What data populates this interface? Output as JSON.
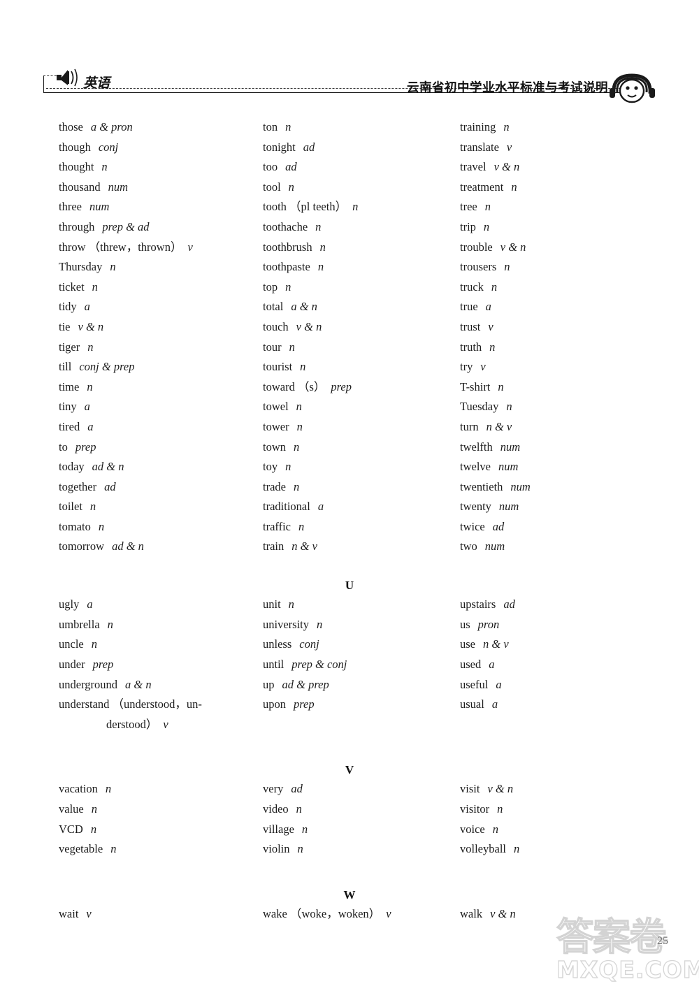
{
  "header": {
    "subject_label": "英语",
    "title": "云南省初中学业水平标准与考试说明",
    "speaker_icon": "speaker-icon",
    "badge_icon": "headphone-face-icon"
  },
  "watermark": {
    "chinese": "答案卷",
    "domain": "MXQE.COM"
  },
  "page_number": "25",
  "sections": [
    {
      "letter": "",
      "columns": [
        [
          {
            "word": "those",
            "forms": "",
            "pos": "a & pron"
          },
          {
            "word": "though",
            "forms": "",
            "pos": "conj"
          },
          {
            "word": "thought",
            "forms": "",
            "pos": "n"
          },
          {
            "word": "thousand",
            "forms": "",
            "pos": "num"
          },
          {
            "word": "three",
            "forms": "",
            "pos": "num"
          },
          {
            "word": "through",
            "forms": "",
            "pos": "prep & ad"
          },
          {
            "word": "throw",
            "forms": "（threw，thrown）",
            "pos": "v"
          },
          {
            "word": "Thursday",
            "forms": "",
            "pos": "n"
          },
          {
            "word": "ticket",
            "forms": "",
            "pos": "n"
          },
          {
            "word": "tidy",
            "forms": "",
            "pos": "a"
          },
          {
            "word": "tie",
            "forms": "",
            "pos": "v & n"
          },
          {
            "word": "tiger",
            "forms": "",
            "pos": "n"
          },
          {
            "word": "till",
            "forms": "",
            "pos": "conj & prep"
          },
          {
            "word": "time",
            "forms": "",
            "pos": "n"
          },
          {
            "word": "tiny",
            "forms": "",
            "pos": "a"
          },
          {
            "word": "tired",
            "forms": "",
            "pos": "a"
          },
          {
            "word": "to",
            "forms": "",
            "pos": "prep"
          },
          {
            "word": "today",
            "forms": "",
            "pos": "ad & n"
          },
          {
            "word": "together",
            "forms": "",
            "pos": "ad"
          },
          {
            "word": "toilet",
            "forms": "",
            "pos": "n"
          },
          {
            "word": "tomato",
            "forms": "",
            "pos": "n"
          },
          {
            "word": "tomorrow",
            "forms": "",
            "pos": "ad & n"
          }
        ],
        [
          {
            "word": "ton",
            "forms": "",
            "pos": "n"
          },
          {
            "word": "tonight",
            "forms": "",
            "pos": "ad"
          },
          {
            "word": "too",
            "forms": "",
            "pos": "ad"
          },
          {
            "word": "tool",
            "forms": "",
            "pos": "n"
          },
          {
            "word": "tooth",
            "forms": "（pl teeth）",
            "pos": "n"
          },
          {
            "word": "toothache",
            "forms": "",
            "pos": "n"
          },
          {
            "word": "toothbrush",
            "forms": "",
            "pos": "n"
          },
          {
            "word": "toothpaste",
            "forms": "",
            "pos": "n"
          },
          {
            "word": "top",
            "forms": "",
            "pos": "n"
          },
          {
            "word": "total",
            "forms": "",
            "pos": "a & n"
          },
          {
            "word": "touch",
            "forms": "",
            "pos": "v & n"
          },
          {
            "word": "tour",
            "forms": "",
            "pos": "n"
          },
          {
            "word": "tourist",
            "forms": "",
            "pos": "n"
          },
          {
            "word": "toward",
            "forms": "（s）",
            "pos": "prep"
          },
          {
            "word": "towel",
            "forms": "",
            "pos": "n"
          },
          {
            "word": "tower",
            "forms": "",
            "pos": "n"
          },
          {
            "word": "town",
            "forms": "",
            "pos": "n"
          },
          {
            "word": "toy",
            "forms": "",
            "pos": "n"
          },
          {
            "word": "trade",
            "forms": "",
            "pos": "n"
          },
          {
            "word": "traditional",
            "forms": "",
            "pos": "a"
          },
          {
            "word": "traffic",
            "forms": "",
            "pos": "n"
          },
          {
            "word": "train",
            "forms": "",
            "pos": "n & v"
          }
        ],
        [
          {
            "word": "training",
            "forms": "",
            "pos": "n"
          },
          {
            "word": "translate",
            "forms": "",
            "pos": "v"
          },
          {
            "word": "travel",
            "forms": "",
            "pos": "v & n"
          },
          {
            "word": "treatment",
            "forms": "",
            "pos": "n"
          },
          {
            "word": "tree",
            "forms": "",
            "pos": "n"
          },
          {
            "word": "trip",
            "forms": "",
            "pos": "n"
          },
          {
            "word": "trouble",
            "forms": "",
            "pos": "v & n"
          },
          {
            "word": "trousers",
            "forms": "",
            "pos": "n"
          },
          {
            "word": "truck",
            "forms": "",
            "pos": "n"
          },
          {
            "word": "true",
            "forms": "",
            "pos": "a"
          },
          {
            "word": "trust",
            "forms": "",
            "pos": "v"
          },
          {
            "word": "truth",
            "forms": "",
            "pos": "n"
          },
          {
            "word": "try",
            "forms": "",
            "pos": "v"
          },
          {
            "word": "T-shirt",
            "forms": "",
            "pos": "n"
          },
          {
            "word": "Tuesday",
            "forms": "",
            "pos": "n"
          },
          {
            "word": "turn",
            "forms": "",
            "pos": "n & v"
          },
          {
            "word": "twelfth",
            "forms": "",
            "pos": "num"
          },
          {
            "word": "twelve",
            "forms": "",
            "pos": "num"
          },
          {
            "word": "twentieth",
            "forms": "",
            "pos": "num"
          },
          {
            "word": "twenty",
            "forms": "",
            "pos": "num"
          },
          {
            "word": "twice",
            "forms": "",
            "pos": "ad"
          },
          {
            "word": "two",
            "forms": "",
            "pos": "num"
          }
        ]
      ]
    },
    {
      "letter": "U",
      "columns": [
        [
          {
            "word": "ugly",
            "forms": "",
            "pos": "a"
          },
          {
            "word": "umbrella",
            "forms": "",
            "pos": "n"
          },
          {
            "word": "uncle",
            "forms": "",
            "pos": "n"
          },
          {
            "word": "under",
            "forms": "",
            "pos": "prep"
          },
          {
            "word": "underground",
            "forms": "",
            "pos": "a & n"
          },
          {
            "word": "understand",
            "forms": "（understood，un-",
            "pos": ""
          },
          {
            "word": "",
            "forms": "derstood）",
            "pos": "v",
            "continuation": true
          }
        ],
        [
          {
            "word": "unit",
            "forms": "",
            "pos": "n"
          },
          {
            "word": "university",
            "forms": "",
            "pos": "n"
          },
          {
            "word": "unless",
            "forms": "",
            "pos": "conj"
          },
          {
            "word": "until",
            "forms": "",
            "pos": "prep & conj"
          },
          {
            "word": "up",
            "forms": "",
            "pos": "ad & prep"
          },
          {
            "word": "upon",
            "forms": "",
            "pos": "prep"
          }
        ],
        [
          {
            "word": "upstairs",
            "forms": "",
            "pos": "ad"
          },
          {
            "word": "us",
            "forms": "",
            "pos": "pron"
          },
          {
            "word": "use",
            "forms": "",
            "pos": "n & v"
          },
          {
            "word": "used",
            "forms": "",
            "pos": "a"
          },
          {
            "word": "useful",
            "forms": "",
            "pos": "a"
          },
          {
            "word": "usual",
            "forms": "",
            "pos": "a"
          }
        ]
      ]
    },
    {
      "letter": "V",
      "columns": [
        [
          {
            "word": "vacation",
            "forms": "",
            "pos": "n"
          },
          {
            "word": "value",
            "forms": "",
            "pos": "n"
          },
          {
            "word": "VCD",
            "forms": "",
            "pos": "n"
          },
          {
            "word": "vegetable",
            "forms": "",
            "pos": "n"
          }
        ],
        [
          {
            "word": "very",
            "forms": "",
            "pos": "ad"
          },
          {
            "word": "video",
            "forms": "",
            "pos": "n"
          },
          {
            "word": "village",
            "forms": "",
            "pos": "n"
          },
          {
            "word": "violin",
            "forms": "",
            "pos": "n"
          }
        ],
        [
          {
            "word": "visit",
            "forms": "",
            "pos": "v & n"
          },
          {
            "word": "visitor",
            "forms": "",
            "pos": "n"
          },
          {
            "word": "voice",
            "forms": "",
            "pos": "n"
          },
          {
            "word": "volleyball",
            "forms": "",
            "pos": "n"
          }
        ]
      ]
    },
    {
      "letter": "W",
      "columns": [
        [
          {
            "word": "wait",
            "forms": "",
            "pos": "v"
          }
        ],
        [
          {
            "word": "wake",
            "forms": "（woke，woken）",
            "pos": "v"
          }
        ],
        [
          {
            "word": "walk",
            "forms": "",
            "pos": "v & n"
          }
        ]
      ]
    }
  ]
}
